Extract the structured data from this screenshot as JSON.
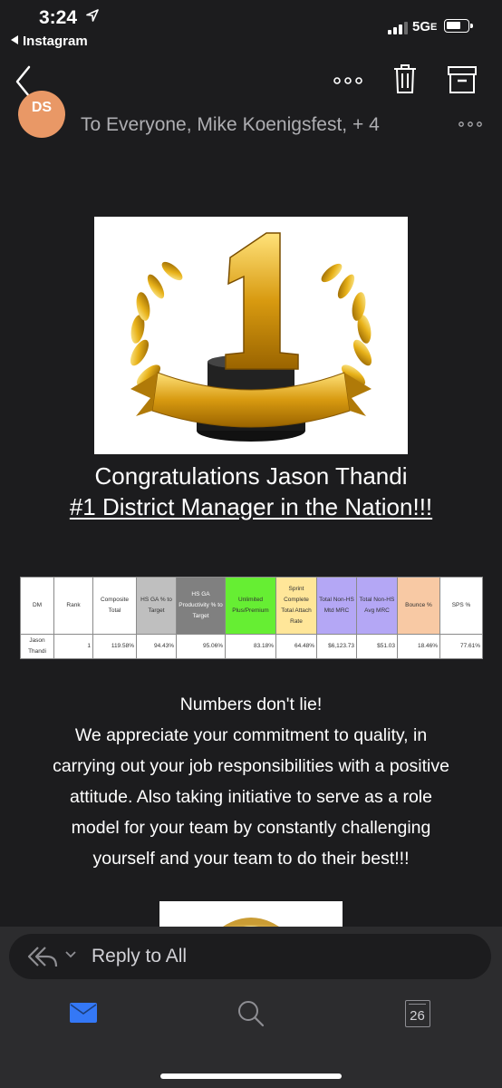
{
  "status_bar": {
    "time": "3:24",
    "back_app": "Instagram",
    "network": "5G",
    "network_suffix": "E",
    "signal_bars": 3,
    "battery_level": 0.7
  },
  "toolbar": {
    "more_icon": "ellipsis-icon",
    "delete_icon": "trash-icon",
    "archive_icon": "archive-icon"
  },
  "header": {
    "avatar_initials": "DS",
    "avatar_color": "#e99866",
    "recipients": "To Everyone, Mike Koenigsfest, + 4"
  },
  "body": {
    "congrats_line1": "Congratulations Jason Thandi",
    "congrats_line2": "#1 District Manager in the Nation!!!",
    "table": {
      "headers": [
        {
          "label": "DM",
          "color": "#ffffff"
        },
        {
          "label": "Rank",
          "color": "#ffffff"
        },
        {
          "label": "Composite Total",
          "color": "#ffffff"
        },
        {
          "label": "HS GA % to Target",
          "color": "#bfbfbf"
        },
        {
          "label": "HS GA Productivity % to Target",
          "color": "#808080"
        },
        {
          "label": "Unlimited Plus/Premium",
          "color": "#66ee33"
        },
        {
          "label": "Sprint Complete Total Attach Rate",
          "color": "#ffe699"
        },
        {
          "label": "Total Non-HS Mtd MRC",
          "color": "#b4a7f5"
        },
        {
          "label": "Total Non-HS Avg MRC",
          "color": "#b4a7f5"
        },
        {
          "label": "Bounce %",
          "color": "#f8c9a4"
        },
        {
          "label": "SPS %",
          "color": "#ffffff"
        }
      ],
      "row": [
        "Jason Thandi",
        "1",
        "119.58%",
        "94.43%",
        "95.06%",
        "83.18%",
        "64.48%",
        "$6,123.73",
        "$51.03",
        "18.46%",
        "77.61%"
      ]
    },
    "message_lines": [
      "Numbers don't lie!",
      "We appreciate your commitment to quality, in",
      "carrying out your job responsibilities with a positive",
      "attitude. Also taking initiative to serve as a role",
      "model for your team by constantly challenging",
      "yourself and your team to do their best!!!"
    ]
  },
  "reply_bar": {
    "label": "Reply to All"
  },
  "tab_bar": {
    "mail_color": "#3478f6",
    "calendar_date": "26"
  }
}
